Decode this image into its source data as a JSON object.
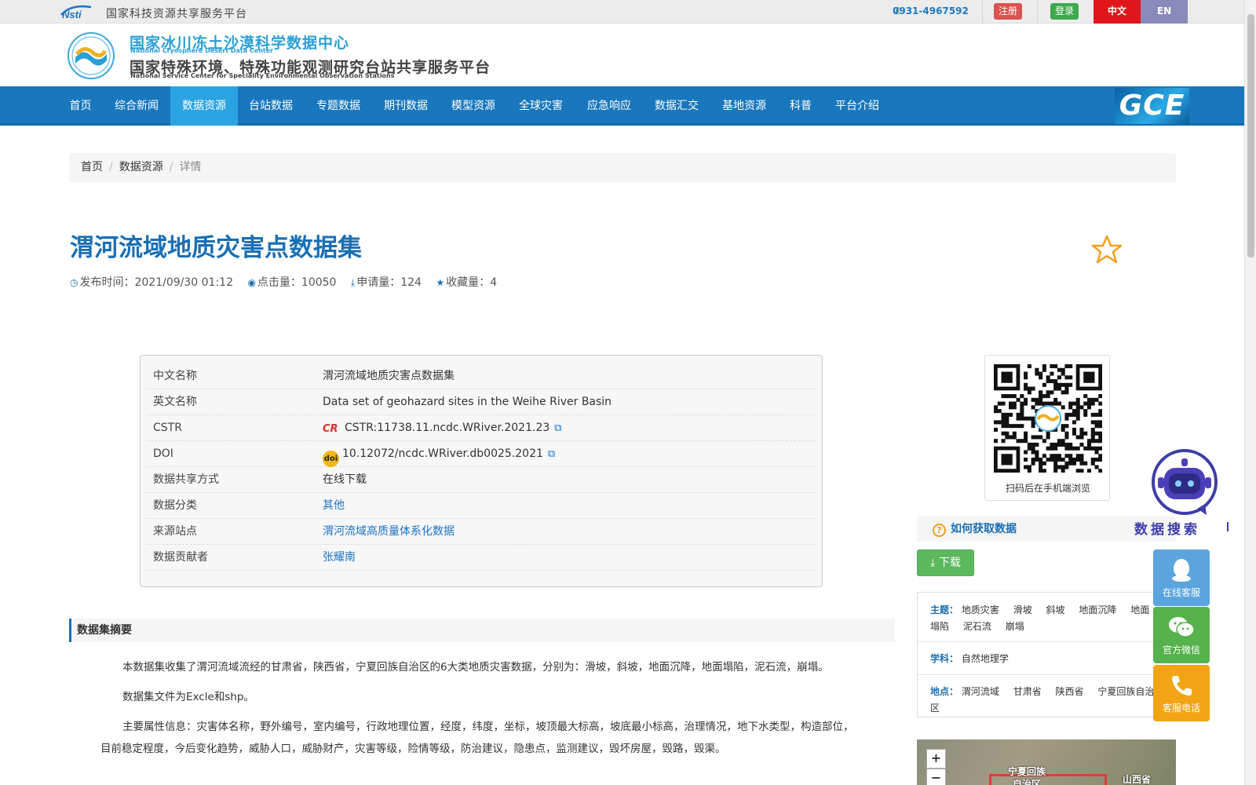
{
  "topbar": {
    "logo_text": "Nsti",
    "platform_title": "国家科技资源共享服务平台",
    "phone": "0931-4967592",
    "register": "注册",
    "login": "登录",
    "lang_zh": "中文",
    "lang_en": "EN"
  },
  "header": {
    "center_name_cn": "国家冰川冻土沙漠科学数据中心",
    "center_name_en": "National Cryosphere Desert Data Center",
    "platform_name_cn": "国家特殊环境、特殊功能观测研究台站共享服务平台",
    "platform_name_en": "National Service Center for Speciality Environmental Observation Stations"
  },
  "nav": {
    "items": [
      "首页",
      "综合新闻",
      "数据资源",
      "台站数据",
      "专题数据",
      "期刊数据",
      "模型资源",
      "全球灾害",
      "应急响应",
      "数据汇交",
      "基地资源",
      "科普",
      "平台介绍"
    ],
    "active": "数据资源",
    "gce_logo": "GCE"
  },
  "breadcrumb": [
    "首页",
    "数据资源",
    "详情"
  ],
  "dataset": {
    "title": "渭河流域地质灾害点数据集",
    "publish_label": "发布时间：",
    "publish_time": "2021/09/30 01:12",
    "clicks_label": "点击量：",
    "clicks": "10050",
    "requests_label": "申请量：",
    "requests": "124",
    "favorites_label": "收藏量：",
    "favorites": "4"
  },
  "info": {
    "rows": [
      {
        "key": "中文名称",
        "value": "渭河流域地质灾害点数据集"
      },
      {
        "key": "英文名称",
        "value": "Data set of geohazard sites in the Weihe River Basin"
      },
      {
        "key": "CSTR",
        "value": "CSTR:11738.11.ncdc.WRiver.2021.23"
      },
      {
        "key": "DOI",
        "value": "10.12072/ncdc.WRiver.db0025.2021"
      },
      {
        "key": "数据共享方式",
        "value": "在线下载"
      },
      {
        "key": "数据分类",
        "value": "其他"
      },
      {
        "key": "来源站点",
        "value": "渭河流域高质量体系化数据"
      },
      {
        "key": "数据贡献者",
        "value": "张耀南"
      }
    ],
    "cstr_badge": "CR",
    "doi_badge": "doi"
  },
  "abstract": {
    "heading": "数据集摘要",
    "paragraphs": [
      "本数据集收集了渭河流域流经的甘肃省，陕西省，宁夏回族自治区的6大类地质灾害数据，分别为：滑坡，斜坡，地面沉降，地面塌陷，泥石流，崩塌。",
      "数据集文件为Excle和shp。",
      "主要属性信息：灾害体名称，野外编号，室内编号，行政地理位置，经度，纬度，坐标，坡顶最大标高，坡底最小标高，治理情况，地下水类型，构造部位，目前稳定程度，今后变化趋势，威胁人口，威胁财产，灾害等级，险情等级，防治建议，隐患点，监测建议，毁坏房屋，毁路，毁渠。"
    ]
  },
  "sidebar": {
    "qr_caption": "扫码后在手机端浏览",
    "howto": "如何获取数据",
    "download": "下载",
    "topic_label": "主题：",
    "topics": [
      "地质灾害",
      "滑坡",
      "斜坡",
      "地面沉降",
      "地面塌陷",
      "泥石流",
      "崩塌"
    ],
    "subject_label": "学科：",
    "subjects": [
      "自然地理学"
    ],
    "place_label": "地点：",
    "places": [
      "渭河流域",
      "甘肃省",
      "陕西省",
      "宁夏回族自治区"
    ],
    "map_labels": {
      "ningxia": "宁夏回族",
      "ningxia2": "自治区",
      "shanxi": "山西省"
    },
    "zoom_in": "+",
    "zoom_out": "−"
  },
  "floating": {
    "search_text": "数据搜索",
    "online_service": "在线客服",
    "wechat": "官方微信",
    "phone": "客服电话"
  },
  "colors": {
    "nav": "#1877bd",
    "nav_active": "#2aa4e3",
    "title": "#1b6fb3",
    "register": "#d9534f",
    "login": "#3fa94f",
    "lang_zh": "#e0161b",
    "lang_en": "#8a89bc",
    "download": "#5cb85c"
  }
}
